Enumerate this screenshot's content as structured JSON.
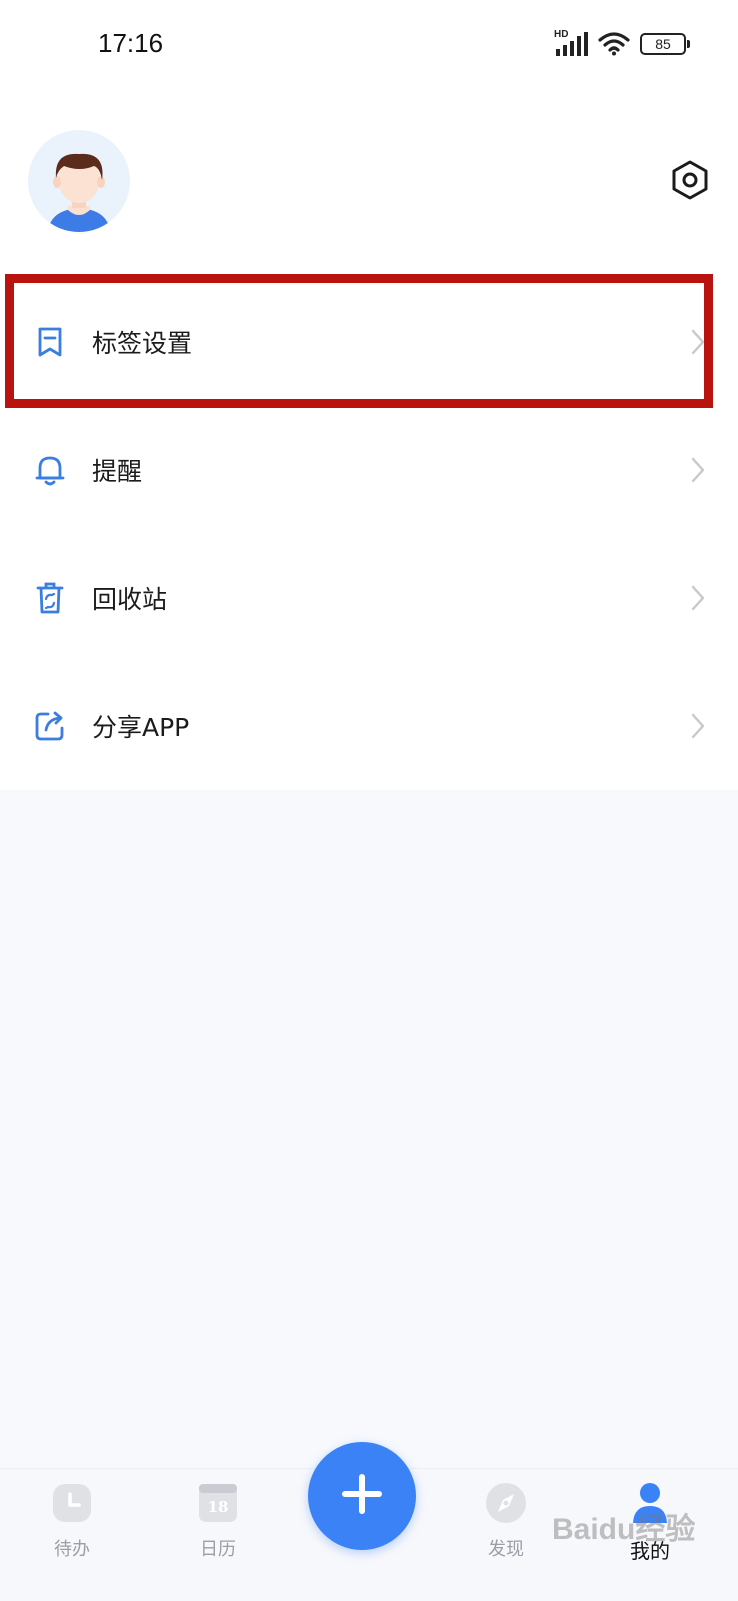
{
  "status_bar": {
    "time": "17:16",
    "network": "HD",
    "battery": "85"
  },
  "menu": [
    {
      "label": "标签设置",
      "icon": "bookmark-icon"
    },
    {
      "label": "提醒",
      "icon": "bell-icon"
    },
    {
      "label": "回收站",
      "icon": "recycle-bin-icon"
    },
    {
      "label": "分享APP",
      "icon": "share-icon"
    }
  ],
  "bottom_nav": {
    "items": [
      {
        "label": "待办",
        "icon": "clock-icon",
        "active": false
      },
      {
        "label": "日历",
        "icon": "calendar-icon",
        "calendar_day": "18",
        "active": false
      },
      {
        "label": "发现",
        "icon": "compass-icon",
        "active": false
      },
      {
        "label": "我的",
        "icon": "person-icon",
        "active": true
      }
    ],
    "add_icon": "plus-icon"
  },
  "colors": {
    "accent": "#3b82f6",
    "highlight_border": "#b8130e",
    "page_bg": "#f7f9fd"
  },
  "watermark": "Baidu经验"
}
